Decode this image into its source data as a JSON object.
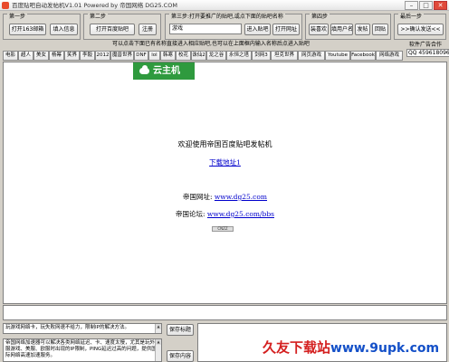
{
  "window": {
    "title": "百度贴吧自动发帖机V1.01 Powered by 帝国网络 DG25.COM",
    "min_glyph": "–",
    "max_glyph": "□",
    "close_glyph": "✕"
  },
  "step1": {
    "label": "第一步",
    "open_163": "打开163邮箱",
    "fill_info": "填入信息"
  },
  "step2": {
    "label": "第二步",
    "open_baidu": "打开百度贴吧",
    "register": "注册"
  },
  "step3": {
    "label": "第三步:打开要推广的贴吧,或点下面的贴吧名称",
    "bar_name": "游戏",
    "enter_bar": "进入贴吧",
    "open_site": "打开网址"
  },
  "step4": {
    "label": "第四步",
    "fav": "装喜欢",
    "fill_user": "填用户名",
    "post": "发帖",
    "back": "回贴"
  },
  "final_step": {
    "label": "最后一步",
    "confirm": ">>确认发送<<"
  },
  "hint": "可以点击下面已有名称直接进入相应贴吧,也可以在上面框内输入名称后点进入贴吧",
  "ad": {
    "title": "软件广告合作",
    "qq": "QQ 459618096"
  },
  "tabs": [
    "电影",
    "超人",
    "美女",
    "杨幂",
    "笑界",
    "李毅",
    "2012",
    "魔兽世界",
    "DNF",
    "lol",
    "韩寒",
    "校花",
    "诛仙2",
    "龙之谷",
    "永恒之塔",
    "剑网3",
    "坦克世界",
    "网页游戏",
    "Youtube",
    "Facebook",
    "网络游戏"
  ],
  "browser": {
    "logo_text": "云主机",
    "welcome": "欢迎使用帝国百度贴吧发帖机",
    "download": "下载地址1",
    "site_label": "帝国网址:",
    "site_url": "www.dg25.com",
    "forum_label": "帝国论坛:",
    "forum_url": "www.dg25.com/bbs",
    "badge": "CNZZ"
  },
  "lower": {
    "title_text": "玩游戏网络卡，玩失败网速不给力，限制IP的解决方法。",
    "content_text": "帝国网络加速器可以解决各类网络延迟、卡、速度太慢，尤其是玩外服游戏、美服、欧服时出现的IP限制，PING延迟过高的问题，提供国际网络高速加速服务。",
    "save_title": "保存标题",
    "save_content": "保存内容"
  },
  "watermark": {
    "name": "久友下载站",
    "url": "www.9upk.com"
  }
}
